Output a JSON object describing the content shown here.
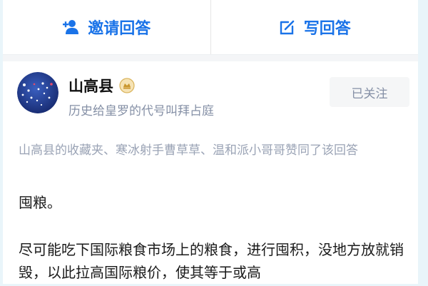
{
  "actions": {
    "invite_label": "邀请回答",
    "write_label": "写回答",
    "invite_icon": "add-user-icon",
    "write_icon": "edit-icon",
    "accent_color": "#1a73e8"
  },
  "answer": {
    "author": {
      "name": "山高县",
      "bio": "历史给皇罗的代号叫拜占庭",
      "avatar_icon": "avatar",
      "badge_icon": "verified-badge-icon"
    },
    "follow_label": "已关注",
    "liked_by": "山高县的收藏夹、寒冰射手曹草草、温和派小哥哥赞同了该回答",
    "paragraphs": [
      "囤粮。",
      "尽可能吃下国际粮食市场上的粮食，进行囤积，没地方放就销毁，以此拉高国际粮价，使其等于或高"
    ]
  }
}
